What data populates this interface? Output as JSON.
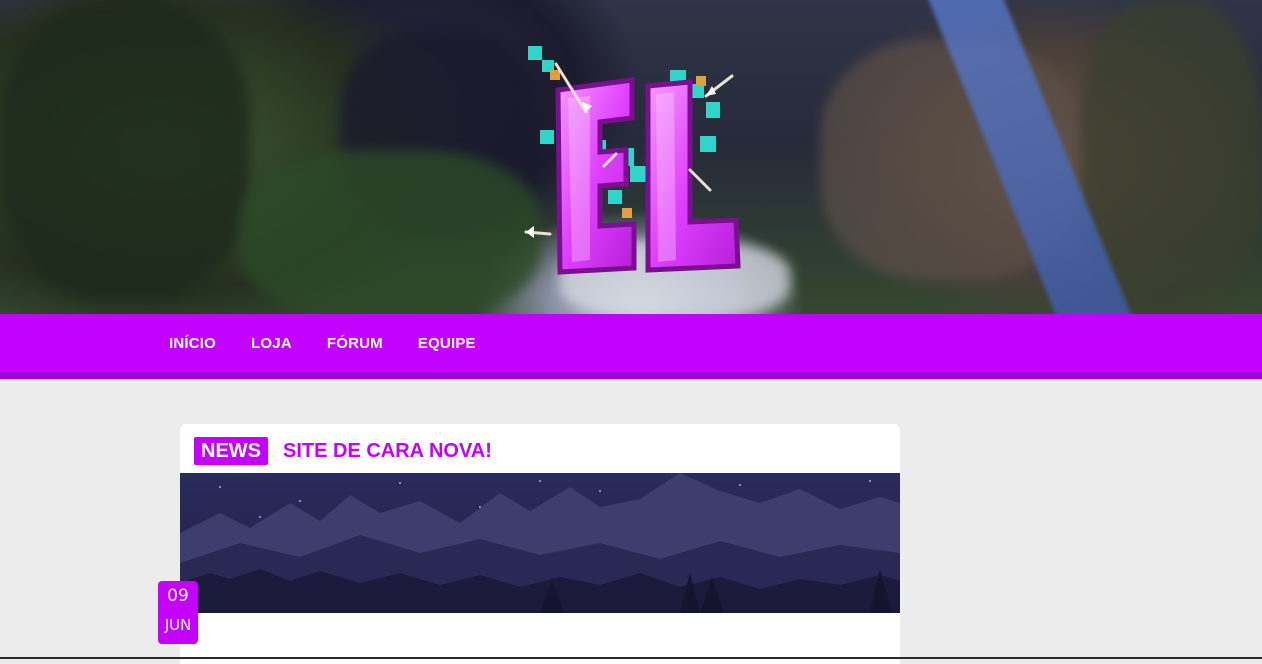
{
  "hero": {
    "logo": {
      "text": "EL",
      "alt": "logo"
    }
  },
  "nav": {
    "items": [
      {
        "label": "INÍCIO"
      },
      {
        "label": "LOJA"
      },
      {
        "label": "FÓRUM"
      },
      {
        "label": "EQUIPE"
      }
    ]
  },
  "post": {
    "badge": "NEWS",
    "title": "SITE DE CARA NOVA!",
    "date": {
      "day": "09",
      "month": "JUN"
    }
  },
  "colors": {
    "accent": "#c400ff",
    "accent_dark": "#a200d6",
    "background": "#ececec",
    "card": "#ffffff",
    "logo_pink": "#e040ff",
    "logo_teal": "#2fd5c8"
  },
  "icons": {
    "logo": "el-crossed-arrows-logo"
  }
}
